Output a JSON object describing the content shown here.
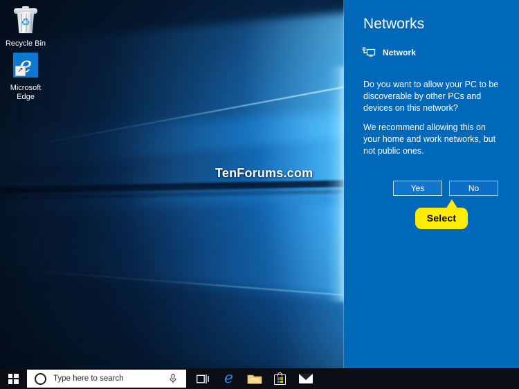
{
  "desktop": {
    "icons": [
      {
        "id": "recycle-bin",
        "label": "Recycle Bin",
        "icon": "recycle-bin-icon"
      },
      {
        "id": "microsoft-edge",
        "label_line1": "Microsoft",
        "label_line2": "Edge",
        "icon": "edge-icon",
        "tile_color": "#0d78d1"
      }
    ],
    "watermark": "TenForums.com"
  },
  "networks_panel": {
    "title": "Networks",
    "background_color": "#0068b8",
    "network_entry": {
      "name": "Network",
      "icon": "network-pc-icon"
    },
    "paragraph_1": "Do you want to allow your PC to be discoverable by other PCs and devices on this network?",
    "paragraph_2": "We recommend allowing this on your home and work networks, but not public ones.",
    "buttons": [
      {
        "id": "yes",
        "label": "Yes",
        "focused": true,
        "fill_color": "#1277cc"
      },
      {
        "id": "no",
        "label": "No",
        "focused": false,
        "fill_color": "#0b6ec2"
      }
    ]
  },
  "annotation": {
    "callout_label": "Select",
    "callout_color": "#ffec00",
    "callout_text_color": "#000000"
  },
  "taskbar": {
    "background_color": "#0b0e14",
    "start": {
      "tooltip": "Start",
      "icon": "windows-logo-icon"
    },
    "search": {
      "placeholder": "Type here to search",
      "left_icon": "cortana-circle-icon",
      "right_icon": "microphone-icon"
    },
    "items": [
      {
        "id": "task-view",
        "label": "Task View",
        "icon": "task-view-icon"
      },
      {
        "id": "edge",
        "label": "Microsoft Edge",
        "icon": "edge-icon"
      },
      {
        "id": "file-explorer",
        "label": "File Explorer",
        "icon": "folder-icon"
      },
      {
        "id": "microsoft-store",
        "label": "Microsoft Store",
        "icon": "store-bag-icon"
      },
      {
        "id": "mail",
        "label": "Mail",
        "icon": "mail-envelope-icon"
      }
    ]
  }
}
